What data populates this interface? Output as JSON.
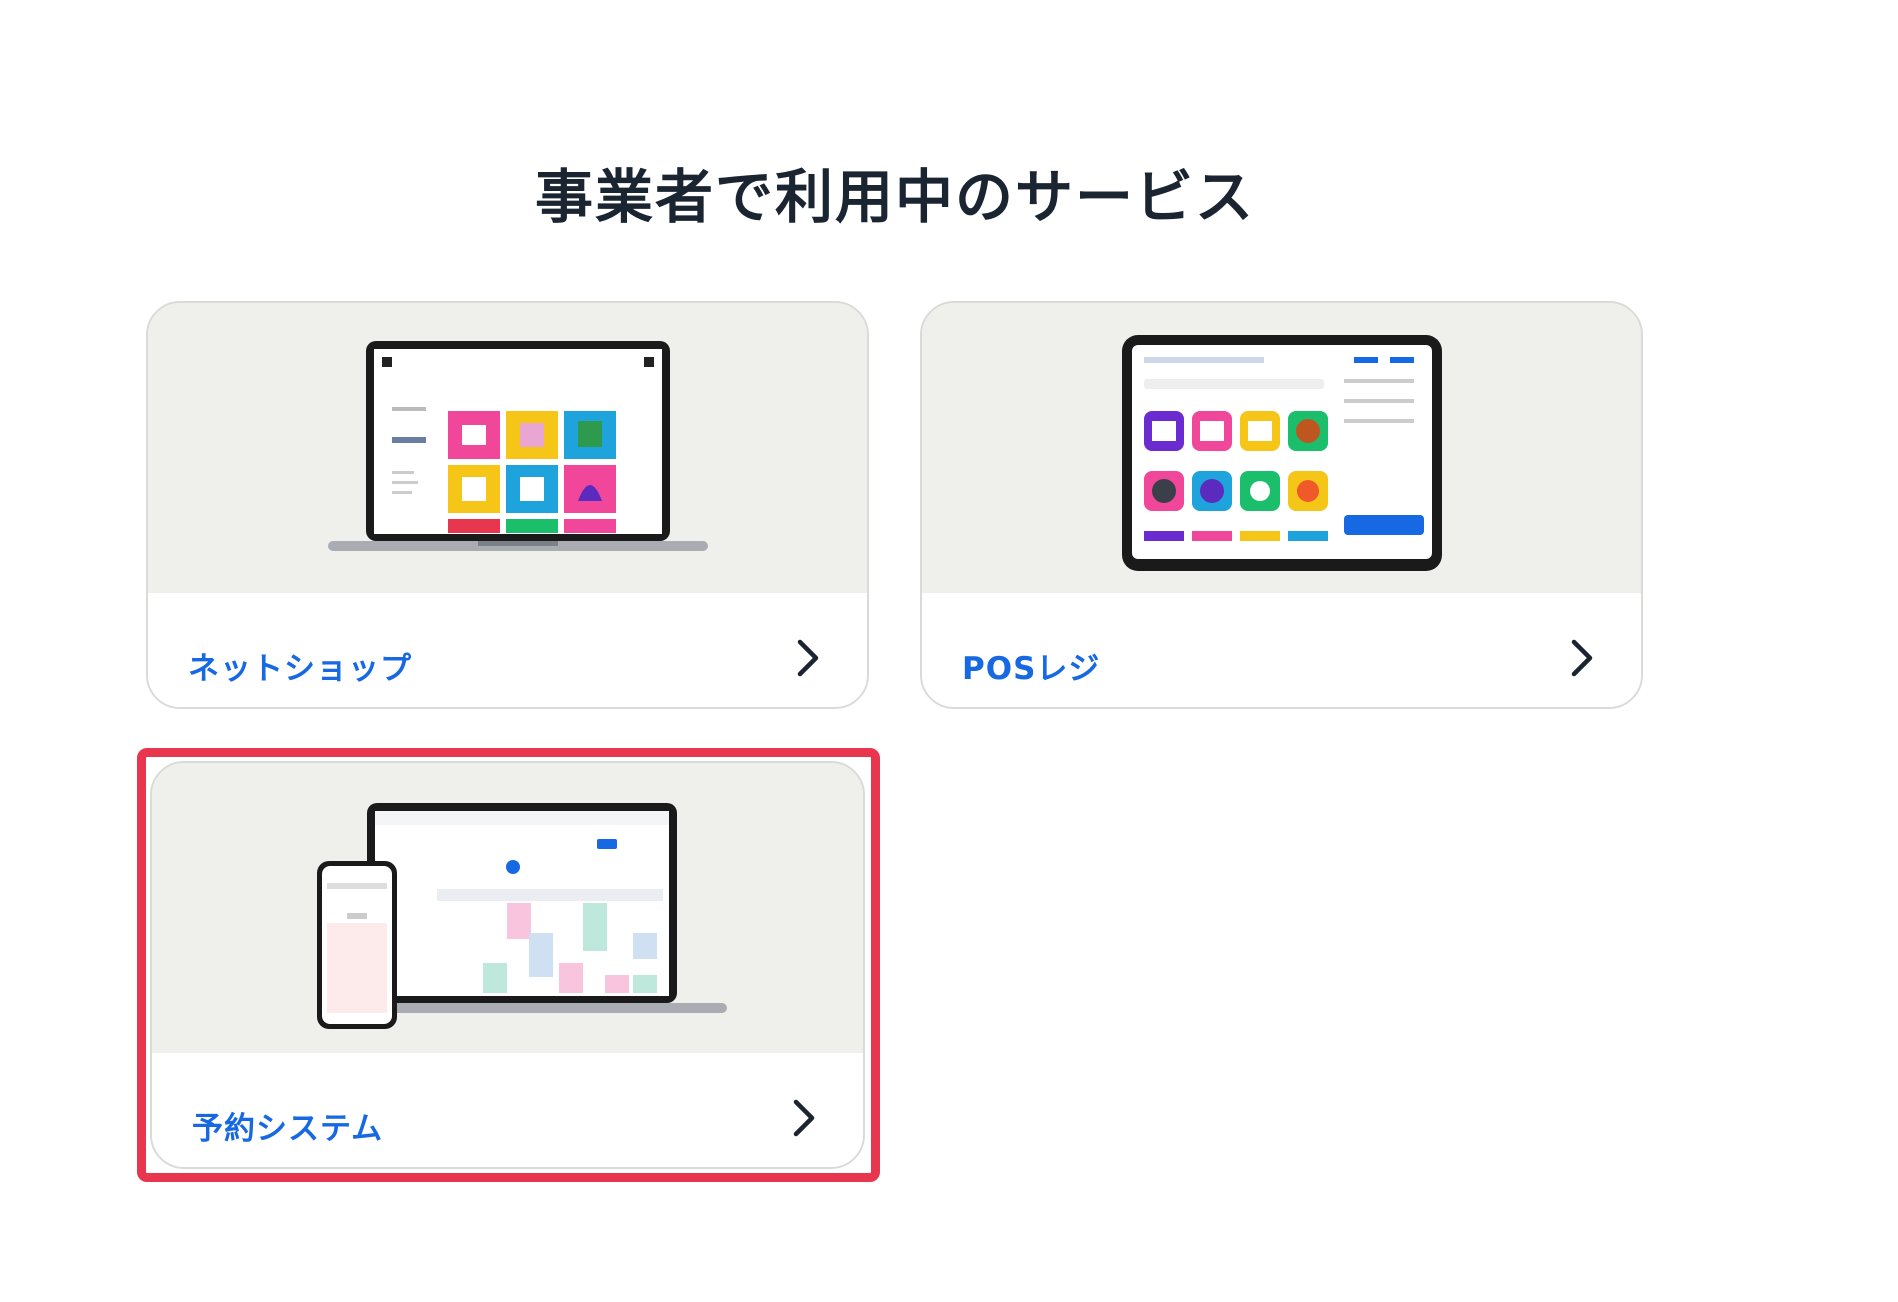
{
  "page": {
    "title": "事業者で利用中のサービス"
  },
  "services": [
    {
      "label": "ネットショップ",
      "icon": "chevron-right-icon",
      "illustration": "laptop-online-shop"
    },
    {
      "label": "POSレジ",
      "icon": "chevron-right-icon",
      "illustration": "tablet-pos-register"
    },
    {
      "label": "予約システム",
      "icon": "chevron-right-icon",
      "illustration": "laptop-phone-reservation-calendar",
      "highlighted": true
    }
  ],
  "colors": {
    "title": "#1b2431",
    "link": "#1668e3",
    "card_visual_bg": "#efefeb",
    "card_border": "#d9dbd7",
    "highlight_border": "#e8364f"
  }
}
